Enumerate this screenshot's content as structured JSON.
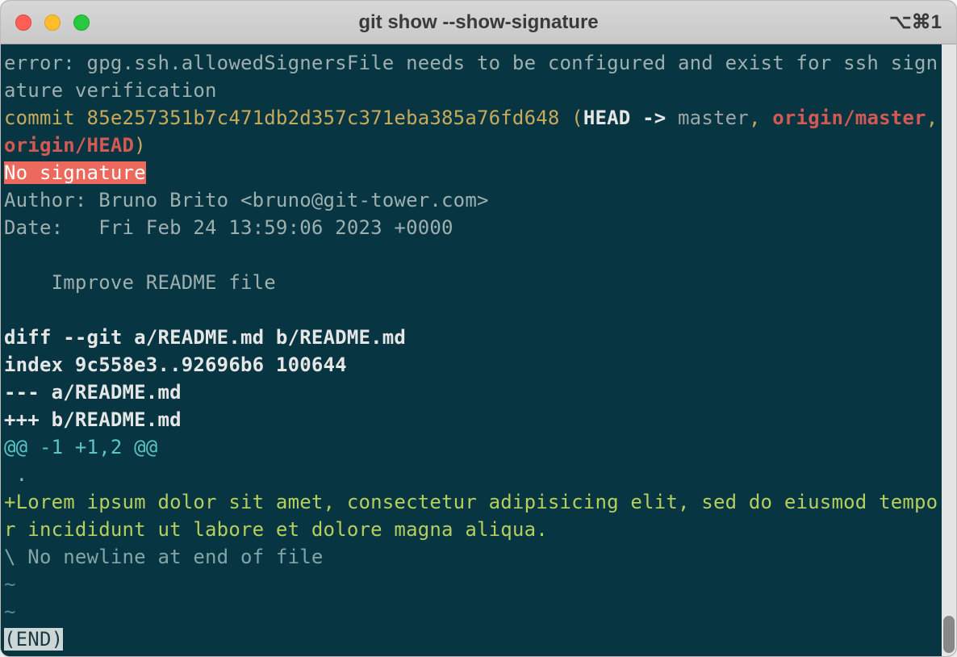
{
  "titlebar": {
    "title": "git show --show-signature",
    "right_indicator": "⌥⌘1"
  },
  "terminal": {
    "error_line": "error: gpg.ssh.allowedSignersFile needs to be configured and exist for ssh signature verification",
    "commit_prefix": "commit 85e257351b7c471db2d357c371eba385a76fd648",
    "refs_open": " (",
    "head_label": "HEAD -> ",
    "master_label": "master",
    "comma_sep1": ", ",
    "origin_master": "origin/master",
    "comma_sep2": ", ",
    "origin_head": "origin/HEAD",
    "refs_close": ")",
    "no_signature": "No signature",
    "author_line": "Author: Bruno Brito <bruno@git-tower.com>",
    "date_line": "Date:   Fri Feb 24 13:59:06 2023 +0000",
    "message": "    Improve README file",
    "diff_header": "diff --git a/README.md b/README.md",
    "index_line": "index 9c558e3..92696b6 100644",
    "minus_file": "--- a/README.md",
    "plus_file": "+++ b/README.md",
    "hunk": "@@ -1 +1,2 @@",
    "context_line": " .",
    "added_line": "+Lorem ipsum dolor sit amet, consectetur adipisicing elit, sed do eiusmod tempor incididunt ut labore et dolore magna aliqua.",
    "no_newline": "\\ No newline at end of file",
    "tilde": "~",
    "end": "(END)"
  }
}
